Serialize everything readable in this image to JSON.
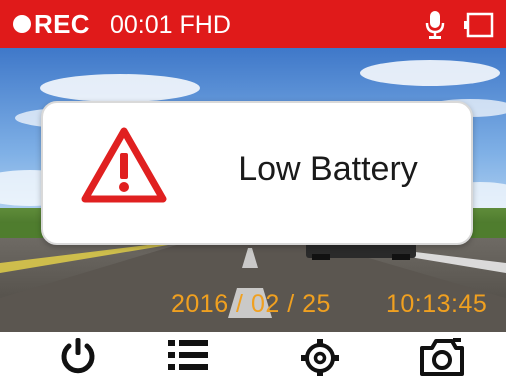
{
  "status_bar": {
    "rec_label": "REC",
    "rec_time": "00:01 FHD",
    "icons": [
      "record-dot-icon",
      "microphone-icon",
      "battery-empty-icon"
    ]
  },
  "alert": {
    "icon": "warning-triangle-icon",
    "message": "Low Battery"
  },
  "overlay": {
    "date": "2016 / 02 / 25",
    "time": "10:13:45"
  },
  "toolbar": {
    "buttons": [
      {
        "icon": "power-icon"
      },
      {
        "icon": "menu-list-icon"
      },
      {
        "icon": "settings-gear-icon"
      },
      {
        "icon": "camera-snapshot-icon"
      }
    ]
  },
  "colors": {
    "status_bar_bg": "#e01a1a",
    "warning": "#e02020",
    "timestamp": "#f0a020"
  }
}
